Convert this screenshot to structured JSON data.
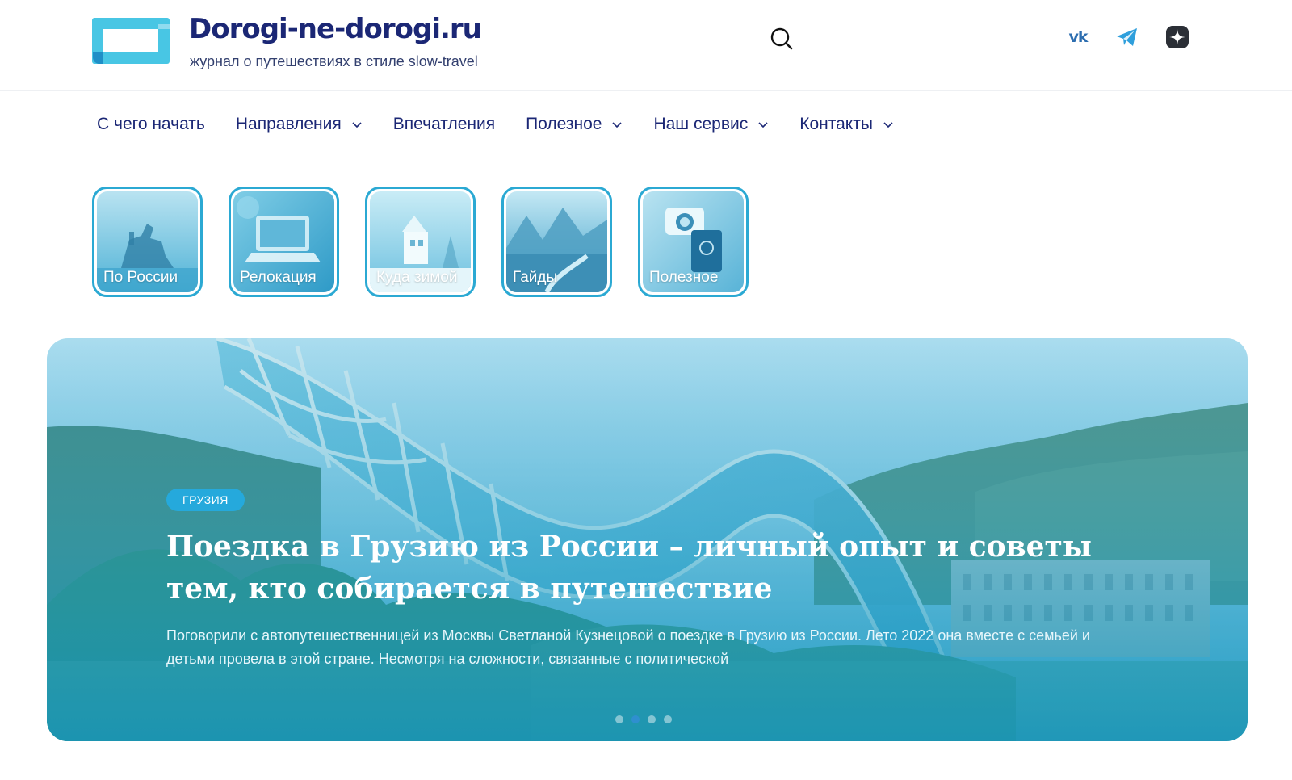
{
  "header": {
    "site_title": "Dorogi-ne-dorogi.ru",
    "site_subtitle": "журнал о путешествиях в стиле slow-travel",
    "social": {
      "vk_label": "vk",
      "icons": [
        "vk-icon",
        "telegram-icon",
        "zen-icon"
      ]
    }
  },
  "nav": {
    "items": [
      {
        "label": "С чего начать",
        "has_dropdown": false
      },
      {
        "label": "Направления",
        "has_dropdown": true
      },
      {
        "label": "Впечатления",
        "has_dropdown": false
      },
      {
        "label": "Полезное",
        "has_dropdown": true
      },
      {
        "label": "Наш сервис",
        "has_dropdown": true
      },
      {
        "label": "Контакты",
        "has_dropdown": true
      }
    ]
  },
  "categories": [
    {
      "label": "По России"
    },
    {
      "label": "Релокация"
    },
    {
      "label": "Куда зимой"
    },
    {
      "label": "Гайды"
    },
    {
      "label": "Полезное"
    }
  ],
  "hero": {
    "badge": "ГРУЗИЯ",
    "title": "Поездка в Грузию из России – личный опыт и советы тем, кто собирается в путешествие",
    "description": "Поговорили с автопутешественницей из Москвы Светланой Кузнецовой о поездке в Грузию из России. Лето 2022 она вместе с семьей и детьми провела в этой стране. Несмотря на сложности, связанные с политической",
    "slides_total": 4,
    "active_slide": 2
  },
  "colors": {
    "brand_dark": "#1b2775",
    "accent": "#25a9dc",
    "tile_border": "#2ba9d3"
  }
}
